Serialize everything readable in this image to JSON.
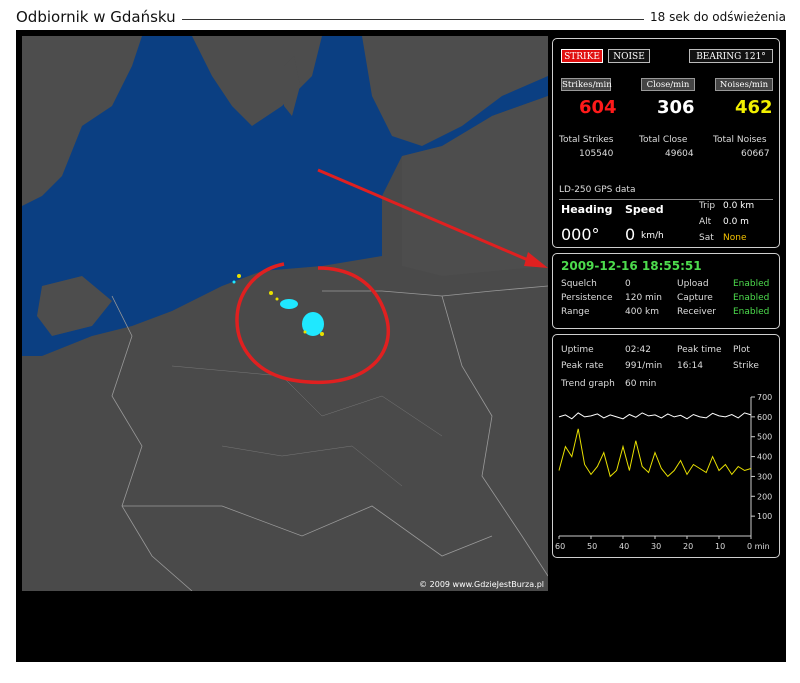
{
  "header": {
    "title": "Odbiornik w Gdańsku",
    "refresh": "18 sek do odświeżenia"
  },
  "map": {
    "copyright": "© 2009 www.GdzieJestBurza.pl"
  },
  "status": {
    "strike_btn": "STRIKE",
    "noise_btn": "NOISE",
    "bearing_btn": "BEARING 121°",
    "strikes_min_label": "Strikes/min",
    "strikes_min": "604",
    "close_min_label": "Close/min",
    "close_min": "306",
    "noises_min_label": "Noises/min",
    "noises_min": "462",
    "total_strikes_label": "Total Strikes",
    "total_strikes": "105540",
    "total_close_label": "Total Close",
    "total_close": "49604",
    "total_noises_label": "Total Noises",
    "total_noises": "60667",
    "gps_title": "LD-250 GPS data",
    "heading_label": "Heading",
    "heading_value": "000°",
    "speed_label": "Speed",
    "speed_value": "0",
    "speed_unit": "km/h",
    "trip_label": "Trip",
    "trip_value": "0.0 km",
    "alt_label": "Alt",
    "alt_value": "0.0 m",
    "sat_label": "Sat",
    "sat_value": "None"
  },
  "settings": {
    "datetime": "2009-12-16 18:55:51",
    "squelch_label": "Squelch",
    "squelch": "0",
    "upload_label": "Upload",
    "upload": "Enabled",
    "persistence_label": "Persistence",
    "persistence": "120 min",
    "capture_label": "Capture",
    "capture": "Enabled",
    "range_label": "Range",
    "range": "400 km",
    "receiver_label": "Receiver",
    "receiver": "Enabled"
  },
  "stats": {
    "uptime_label": "Uptime",
    "uptime": "02:42",
    "peak_time_label": "Peak time",
    "plot_label": "Plot",
    "peak_rate_label": "Peak rate",
    "peak_rate": "991/min",
    "peak_time": "16:14",
    "plot": "Strike",
    "trend_label": "Trend graph",
    "trend_window": "60 min"
  },
  "chart_data": {
    "type": "line",
    "y_ticks": [
      "700",
      "600",
      "500",
      "400",
      "300",
      "200",
      "100"
    ],
    "x_ticks": [
      "60",
      "50",
      "40",
      "30",
      "20",
      "10",
      "0 min"
    ],
    "ylim": [
      0,
      700
    ],
    "xlim": [
      60,
      0
    ],
    "series": [
      {
        "color": "#ffffff",
        "x": [
          60,
          58,
          56,
          54,
          52,
          50,
          48,
          46,
          44,
          42,
          40,
          38,
          36,
          34,
          32,
          30,
          28,
          26,
          24,
          22,
          20,
          18,
          16,
          14,
          12,
          10,
          8,
          6,
          4,
          2,
          0
        ],
        "y": [
          600,
          610,
          590,
          620,
          600,
          605,
          615,
          595,
          610,
          600,
          590,
          612,
          598,
          620,
          605,
          610,
          595,
          615,
          600,
          608,
          590,
          612,
          600,
          595,
          618,
          605,
          600,
          612,
          595,
          620,
          610
        ]
      },
      {
        "color": "#e8e000",
        "x": [
          60,
          58,
          56,
          54,
          52,
          50,
          48,
          46,
          44,
          42,
          40,
          38,
          36,
          34,
          32,
          30,
          28,
          26,
          24,
          22,
          20,
          18,
          16,
          14,
          12,
          10,
          8,
          6,
          4,
          2,
          0
        ],
        "y": [
          330,
          450,
          400,
          540,
          360,
          310,
          350,
          420,
          300,
          330,
          450,
          330,
          480,
          350,
          320,
          420,
          340,
          300,
          330,
          380,
          310,
          360,
          340,
          320,
          400,
          330,
          360,
          310,
          350,
          330,
          340
        ]
      }
    ]
  }
}
